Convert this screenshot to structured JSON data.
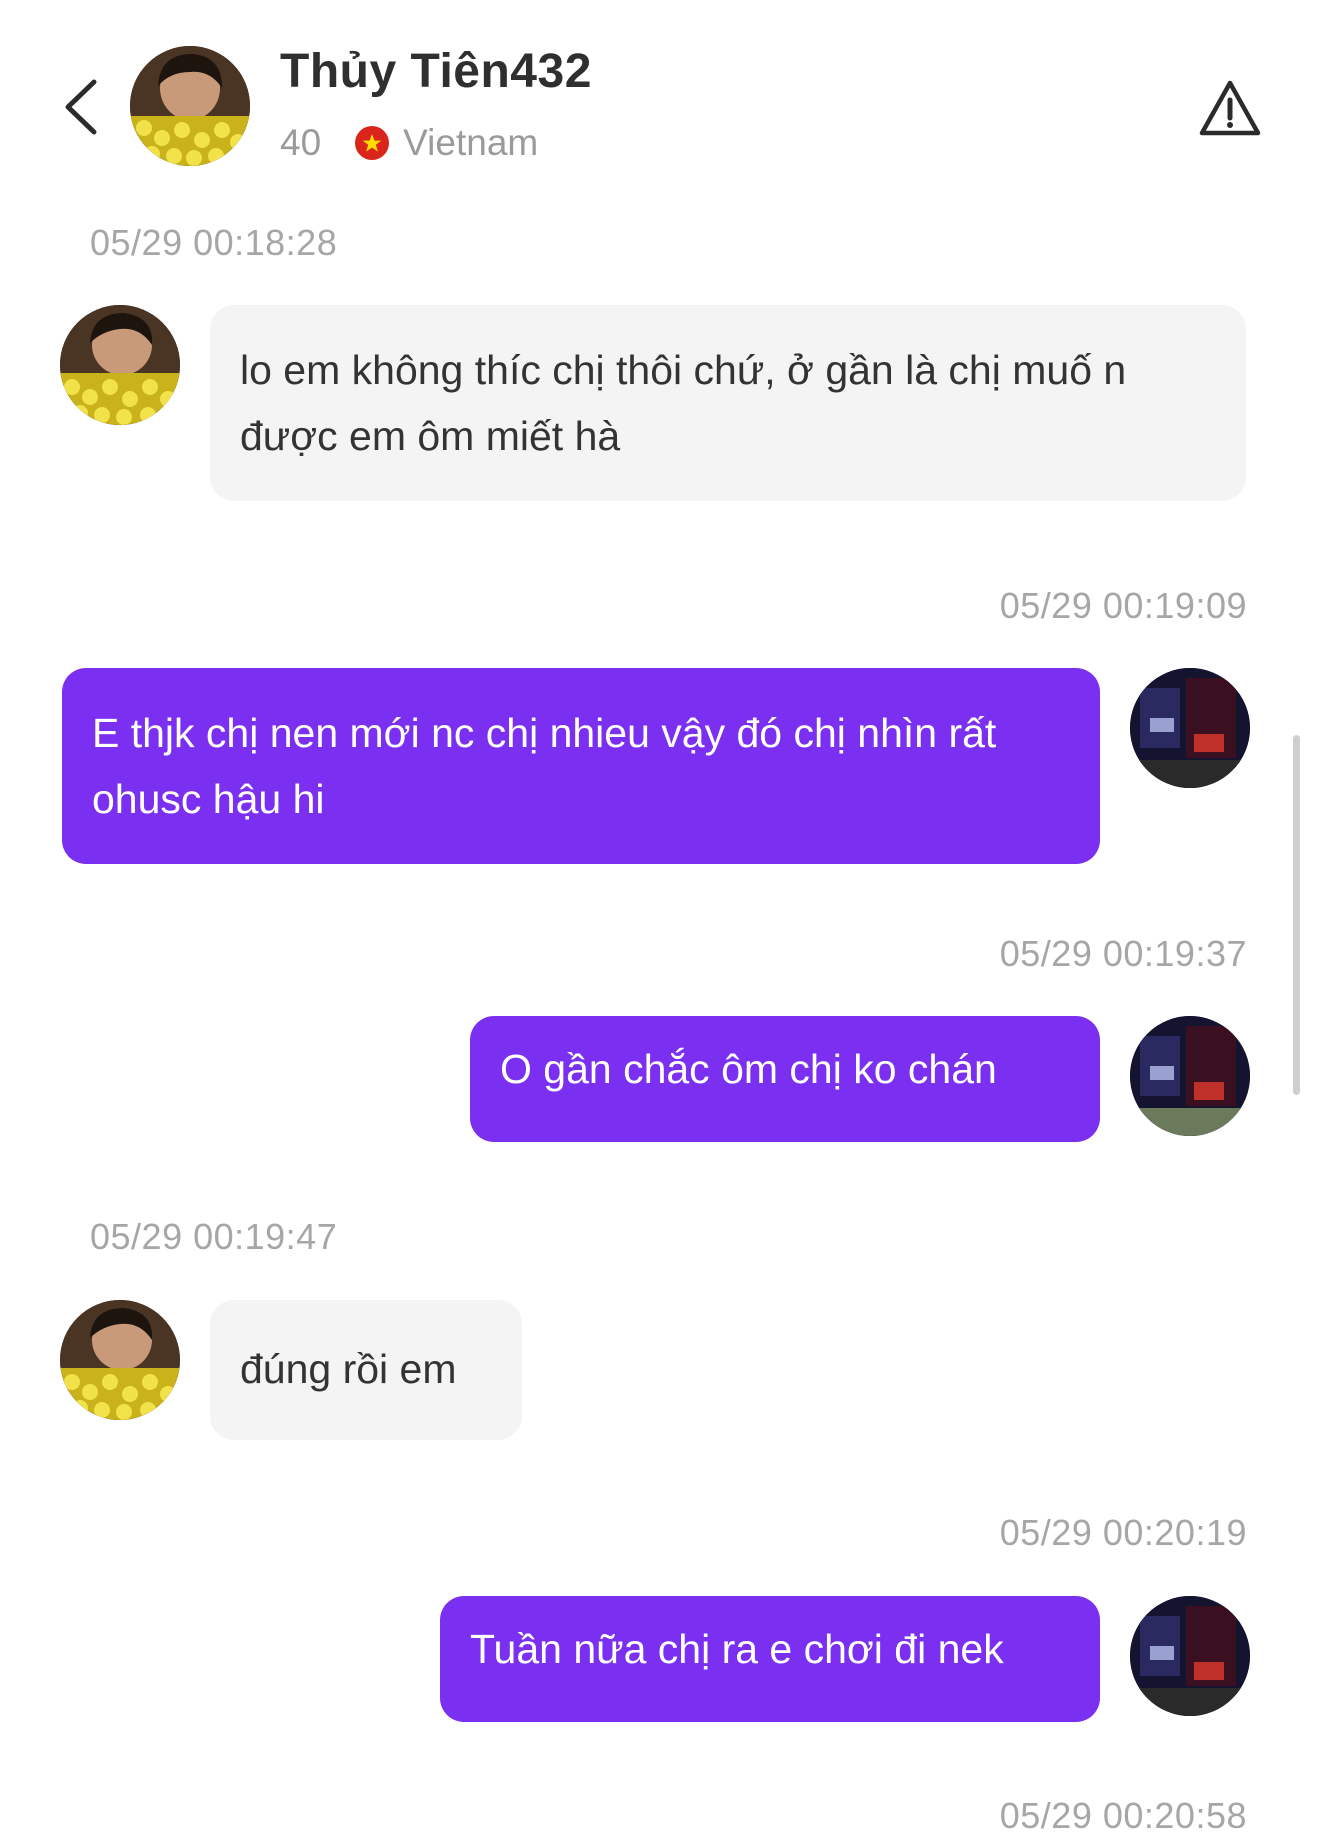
{
  "header": {
    "title": "Thủy Tiên432",
    "age": "40",
    "country": "Vietnam",
    "back_icon": "chevron-left-icon",
    "report_icon": "warning-triangle-icon"
  },
  "colors": {
    "outgoing_bubble": "#7b2ff0",
    "incoming_bubble": "#f4f4f4",
    "timestamp": "#a6a6a6"
  },
  "messages": [
    {
      "timestamp": "05/29 00:18:28",
      "sender": "them",
      "text": "lo em không thíc chị thôi chứ, ở gần là chị muố n được em ôm miết hà"
    },
    {
      "timestamp": "05/29 00:19:09",
      "sender": "me",
      "text": "E thjk chị nen mới nc chị nhieu vậy đó chị nhìn rất ohusc hậu hi"
    },
    {
      "timestamp": "05/29 00:19:37",
      "sender": "me",
      "text": "O gần chắc ôm chị ko chán"
    },
    {
      "timestamp": "05/29 00:19:47",
      "sender": "them",
      "text": "đúng rồi em"
    },
    {
      "timestamp": "05/29 00:20:19",
      "sender": "me",
      "text": "Tuần nữa chị ra e chơi đi nek"
    },
    {
      "timestamp": "05/29 00:20:58",
      "sender": "me",
      "text": ""
    }
  ]
}
